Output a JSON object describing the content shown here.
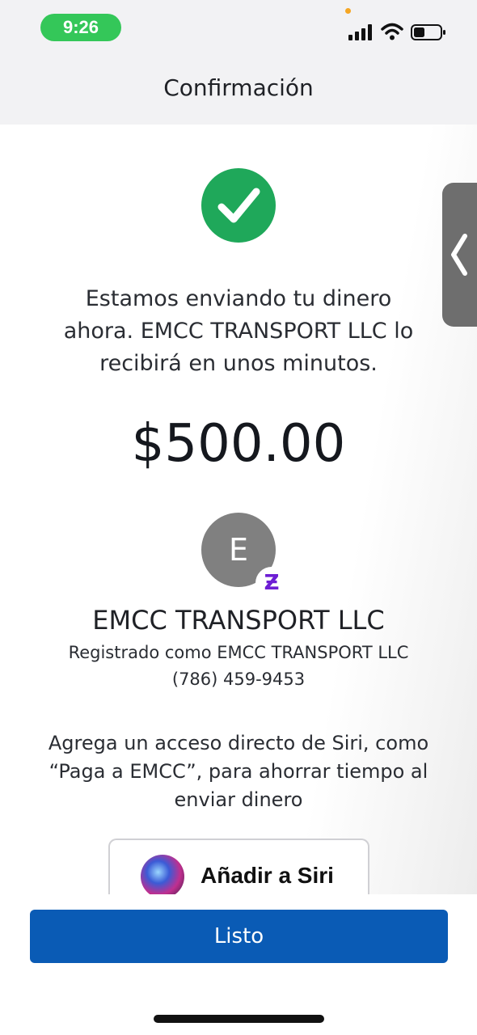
{
  "status_bar": {
    "time": "9:26",
    "time_pill_color": "#34c759",
    "icons": [
      "cellular-signal-icon",
      "wifi-icon",
      "battery-icon"
    ]
  },
  "header": {
    "title": "Confirmación"
  },
  "confirmation": {
    "icon": "checkmark-circle-icon",
    "icon_color": "#1fa85a",
    "message": "Estamos enviando tu dinero ahora. EMCC TRANSPORT LLC lo recibirá en unos minutos.",
    "amount": "$500.00"
  },
  "recipient": {
    "avatar_initial": "E",
    "badge_icon": "zelle-icon",
    "badge_glyph": "Ƶ",
    "name": "EMCC TRANSPORT LLC",
    "registered_as": "Registrado como EMCC TRANSPORT LLC",
    "phone": "(786) 459-9453"
  },
  "siri": {
    "prompt": "Agrega un acceso directo de Siri, como “Paga a EMCC”, para ahorrar tiempo al enviar dinero",
    "button_label": "Añadir a Siri"
  },
  "side_tab": {
    "icon": "chevron-left-icon"
  },
  "footer": {
    "done_label": "Listo",
    "button_color": "#0a5bb5"
  }
}
